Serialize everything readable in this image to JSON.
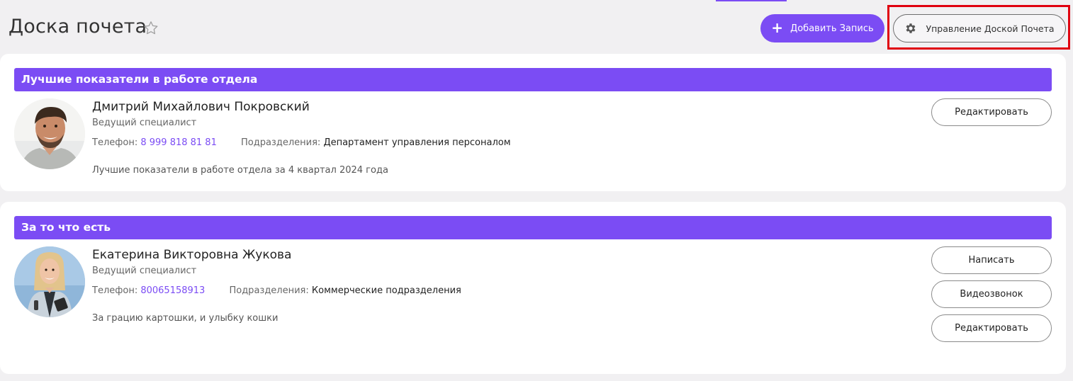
{
  "header": {
    "title": "Доска почета",
    "add_button_label": "Добавить Запись",
    "manage_button_label": "Управление Доской Почета"
  },
  "colors": {
    "accent": "#7b4cf4",
    "highlight": "#e0000f",
    "background": "#f1f0f2"
  },
  "cards": [
    {
      "category": "Лучшие показатели в работе отдела",
      "name": "Дмитрий Михайлович Покровский",
      "position": "Ведущий специалист",
      "phone_label": "Телефон:",
      "phone": "8 999 818 81 81",
      "department_label": "Подразделения:",
      "department": "Департамент управления персоналом",
      "note": "Лучшие показатели в работе отдела за 4 квартал 2024 года",
      "actions": [
        "Редактировать"
      ]
    },
    {
      "category": "За то что есть",
      "name": "Екатерина Викторовна Жукова",
      "position": "Ведущий специалист",
      "phone_label": "Телефон:",
      "phone": "80065158913",
      "department_label": "Подразделения:",
      "department": "Коммерческие подразделения",
      "note": "За грацию картошки, и улыбку кошки",
      "actions": [
        "Написать",
        "Видеозвонок",
        "Редактировать"
      ]
    }
  ]
}
